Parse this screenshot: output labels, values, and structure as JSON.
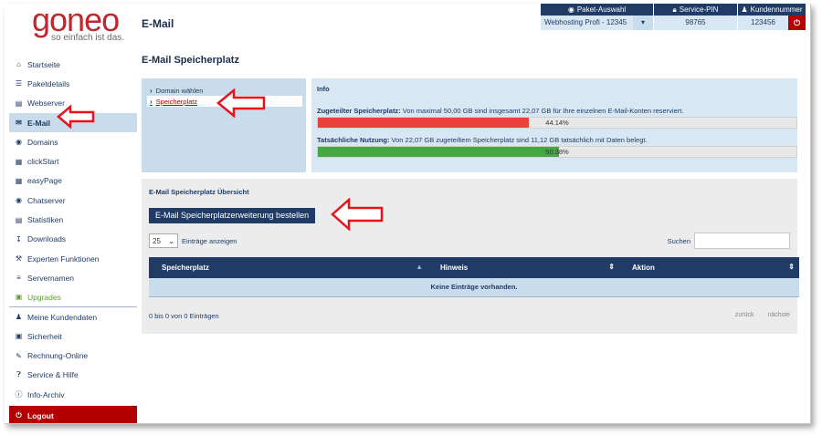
{
  "brand": {
    "name": "goneo",
    "tagline": "so einfach ist das.",
    "color": "#c0272d"
  },
  "page": {
    "header_title": "E-Mail",
    "section_title": "E-Mail Speicherplatz"
  },
  "account": {
    "package_header": "Paket-Auswahl",
    "package_value": "Webhosting Profi - 12345",
    "pin_header": "Service-PIN",
    "pin_value": "98765",
    "customer_header": "Kundennummer",
    "customer_value": "123456"
  },
  "sidebar": {
    "items": [
      {
        "label": "Startseite",
        "icon": "home-icon"
      },
      {
        "label": "Paketdetails",
        "icon": "list-icon"
      },
      {
        "label": "Webserver",
        "icon": "server-icon"
      },
      {
        "label": "E-Mail",
        "icon": "envelope-icon"
      },
      {
        "label": "Domains",
        "icon": "globe-icon"
      },
      {
        "label": "clickStart",
        "icon": "cubes-icon"
      },
      {
        "label": "easyPage",
        "icon": "grid-icon"
      },
      {
        "label": "Chatserver",
        "icon": "chat-icon"
      },
      {
        "label": "Statistiken",
        "icon": "chart-icon"
      },
      {
        "label": "Downloads",
        "icon": "download-icon"
      },
      {
        "label": "Experten Funktionen",
        "icon": "wrench-icon"
      },
      {
        "label": "Servernamen",
        "icon": "menu-icon"
      },
      {
        "label": "Upgrades",
        "icon": "cart-icon"
      },
      {
        "label": "Meine Kundendaten",
        "icon": "user-icon"
      },
      {
        "label": "Sicherheit",
        "icon": "lock-icon"
      },
      {
        "label": "Rechnung-Online",
        "icon": "pencil-icon"
      },
      {
        "label": "Service & Hilfe",
        "icon": "question-icon"
      },
      {
        "label": "Info-Archiv",
        "icon": "info-icon"
      },
      {
        "label": "Logout",
        "icon": "power-icon"
      }
    ]
  },
  "steps": [
    {
      "label": "Domain wählen"
    },
    {
      "label": "Speicherplatz"
    }
  ],
  "info": {
    "title": "Info",
    "allocated_label": "Zugeteilter Speicherplatz:",
    "allocated_text": "Von maximal 50,00 GB sind insgesamt 22,07 GB für Ihre einzelnen E-Mail-Konten reserviert.",
    "allocated_percent_label": "44.14%",
    "allocated_fraction": 0.4414,
    "used_label": "Tatsächliche Nutzung:",
    "used_text": "Von 22,07 GB zugeteiltem Speicherplatz sind 11,12 GB tatsächlich mit Daten belegt.",
    "used_percent_label": "50.38%",
    "used_fraction": 0.5038,
    "allocated_color": "#e8423b",
    "used_color": "#43a843"
  },
  "overview": {
    "title": "E-Mail Speicherplatz Übersicht",
    "order_button": "E-Mail Speicherplatzerweiterung bestellen",
    "length_value": "25",
    "length_suffix": "Einträge anzeigen",
    "search_label": "Suchen",
    "columns": [
      "Speicherplatz",
      "Hinweis",
      "Aktion"
    ],
    "empty_text": "Keine Einträge vorhanden.",
    "summary": "0 bis 0 von 0 Einträgen",
    "prev": "zurück",
    "next": "nächste"
  },
  "colors": {
    "navy": "#1f3b66",
    "light_blue": "#c9dcec",
    "logout": "#b30000",
    "upgrades": "#5aa02c",
    "arrow": "#e8131a"
  }
}
